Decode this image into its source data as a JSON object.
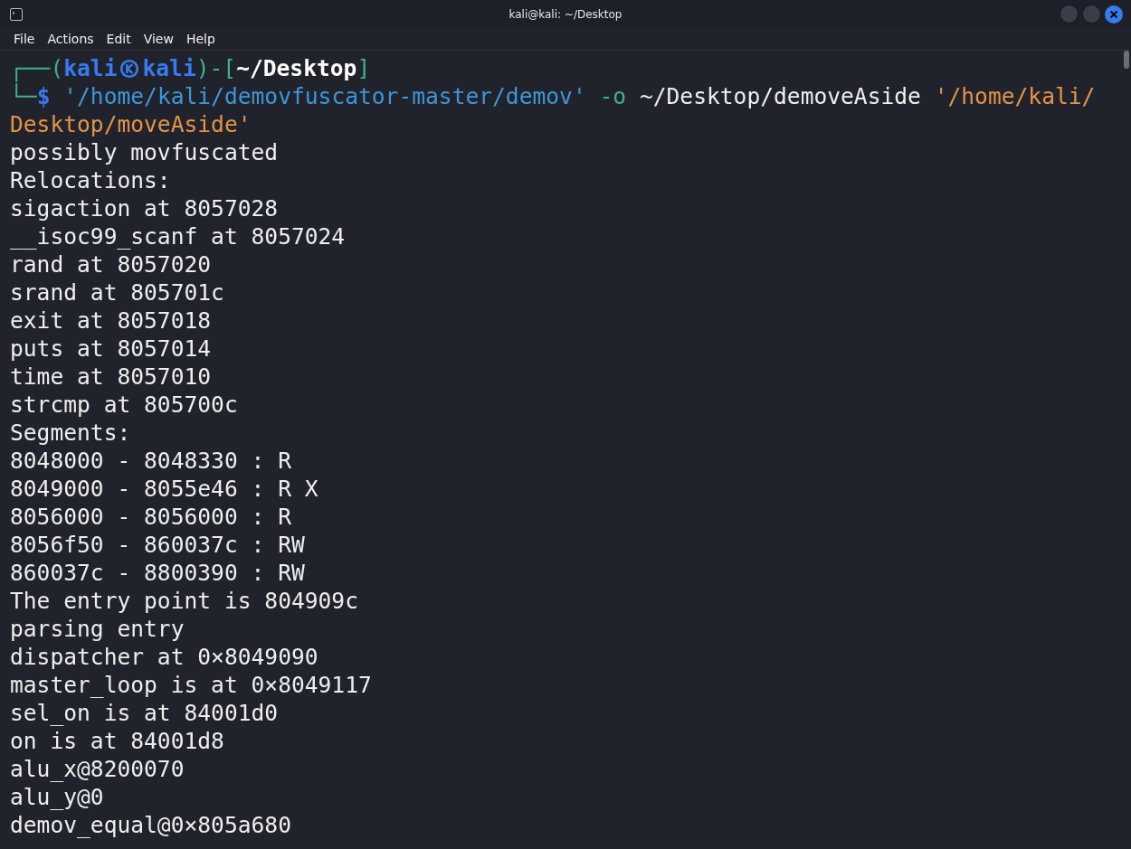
{
  "window": {
    "title": "kali@kali: ~/Desktop"
  },
  "menu": [
    "File",
    "Actions",
    "Edit",
    "View",
    "Help"
  ],
  "prompt": {
    "frame_top": "┌──(",
    "user": "kali",
    "host": "kali",
    "separator": ")-[",
    "cwd": "~/Desktop",
    "close": "]",
    "frame_bottom": "└─",
    "symbol": "$"
  },
  "command": [
    {
      "kind": "path",
      "text": "'/home/kali/demovfuscator-master/demov'"
    },
    {
      "kind": "option",
      "text": " -o "
    },
    {
      "kind": "plain",
      "text": "~/Desktop/demoveAside "
    },
    {
      "kind": "quoted",
      "text": "'/home/kali/"
    }
  ],
  "command_wrap": [
    {
      "kind": "quoted",
      "text": "Desktop/moveAside'"
    }
  ],
  "output": [
    "possibly movfuscated",
    "Relocations:",
    "sigaction at 8057028",
    "__isoc99_scanf at 8057024",
    "rand at 8057020",
    "srand at 805701c",
    "exit at 8057018",
    "puts at 8057014",
    "time at 8057010",
    "strcmp at 805700c",
    "Segments:",
    "8048000 - 8048330 : R",
    "8049000 - 8055e46 : R X",
    "8056000 - 8056000 : R",
    "8056f50 - 860037c : RW",
    "860037c - 8800390 : RW",
    "The entry point is 804909c",
    "parsing entry",
    "dispatcher at 0×8049090",
    "master_loop is at 0×8049117",
    "sel_on is at 84001d0",
    "on is at 84001d8",
    "alu_x@8200070",
    "alu_y@0",
    "demov_equal@0×805a680"
  ]
}
